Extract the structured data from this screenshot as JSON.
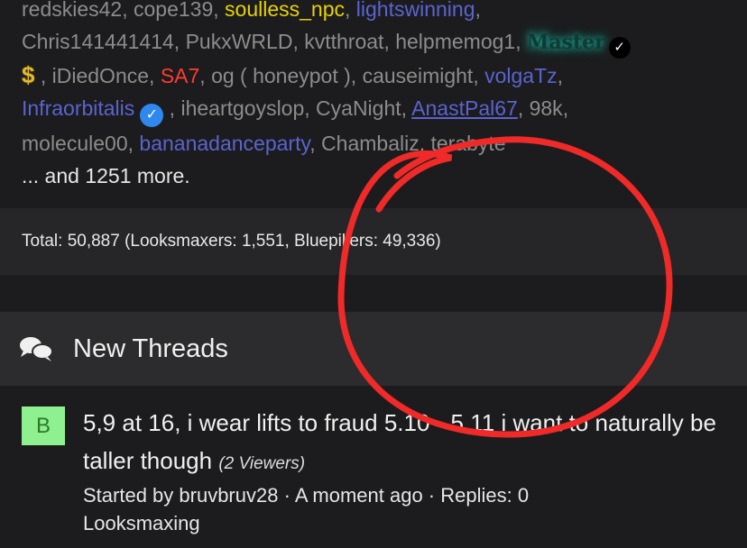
{
  "online_users": {
    "lines": [
      [
        {
          "text": "redskies42",
          "style": "u"
        },
        {
          "text": ", ",
          "style": "sep"
        },
        {
          "text": "cope139",
          "style": "u"
        },
        {
          "text": ", ",
          "style": "sep"
        },
        {
          "text": "soulless_npc",
          "style": "u yellow"
        },
        {
          "text": ", ",
          "style": "sep"
        },
        {
          "text": "lightswinning",
          "style": "u blue"
        },
        {
          "text": ",",
          "style": "sep"
        }
      ],
      [
        {
          "text": "Chris141441414",
          "style": "u"
        },
        {
          "text": ", ",
          "style": "sep"
        },
        {
          "text": "PukxWRLD",
          "style": "u"
        },
        {
          "text": ", ",
          "style": "sep"
        },
        {
          "text": "kvtthroat",
          "style": "u"
        },
        {
          "text": ", ",
          "style": "sep"
        },
        {
          "text": "helpmemog1",
          "style": "u"
        },
        {
          "text": ", ",
          "style": "sep"
        },
        {
          "text": "Master",
          "style": "u master"
        },
        {
          "badge": "verified-dark"
        }
      ],
      [
        {
          "icon": "dollar-icon"
        },
        {
          "text": " , ",
          "style": "sep"
        },
        {
          "text": "iDiedOnce",
          "style": "u"
        },
        {
          "text": ", ",
          "style": "sep"
        },
        {
          "text": "SA7",
          "style": "u red"
        },
        {
          "text": ", ",
          "style": "sep"
        },
        {
          "text": "og ( honeypot )",
          "style": "u"
        },
        {
          "text": ", ",
          "style": "sep"
        },
        {
          "text": "causeimight",
          "style": "u"
        },
        {
          "text": ", ",
          "style": "sep"
        },
        {
          "text": "volgaTz",
          "style": "u blue"
        },
        {
          "text": ",",
          "style": "sep"
        }
      ],
      [
        {
          "text": "Infraorbitalis",
          "style": "u infra"
        },
        {
          "badge": "verified-blue"
        },
        {
          "text": " , ",
          "style": "sep"
        },
        {
          "text": "iheartgoyslop",
          "style": "u"
        },
        {
          "text": ", ",
          "style": "sep"
        },
        {
          "text": "CyaNight",
          "style": "u"
        },
        {
          "text": ", ",
          "style": "sep"
        },
        {
          "text": "AnastPal67",
          "style": "u anast"
        },
        {
          "text": ", ",
          "style": "sep"
        },
        {
          "text": "98k",
          "style": "u"
        },
        {
          "text": ",",
          "style": "sep"
        }
      ],
      [
        {
          "text": "molecule00",
          "style": "u"
        },
        {
          "text": ", ",
          "style": "sep"
        },
        {
          "text": "bananadanceparty",
          "style": "u blue"
        },
        {
          "text": ", ",
          "style": "sep"
        },
        {
          "text": "Chambaliz",
          "style": "u"
        },
        {
          "text": ", ",
          "style": "sep"
        },
        {
          "text": "terabyte",
          "style": "u"
        }
      ]
    ],
    "more_text": "... and 1251 more."
  },
  "totals": {
    "text": "Total: 50,887 (Looksmaxers: 1,551, Bluepillers: 49,336)"
  },
  "threads_section": {
    "icon": "comments-icon",
    "title": "New Threads"
  },
  "thread": {
    "avatar_letter": "B",
    "avatar_color": "#8ff08f",
    "title": "5,9 at 16, i wear lifts to fraud 5.10 - 5.11 i want to naturally be taller though",
    "viewers": "(2 Viewers)",
    "started_by_prefix": "Started by ",
    "author": "bruvbruv28",
    "sep1": " · ",
    "time": "A moment ago",
    "sep2": " · ",
    "replies": "Replies: 0",
    "forum": "Looksmaxing"
  },
  "colors": {
    "annotation_red": "#f02a28",
    "link_blue": "#5a64cf",
    "name_yellow": "#e7d200",
    "name_red": "#ff3b30"
  }
}
